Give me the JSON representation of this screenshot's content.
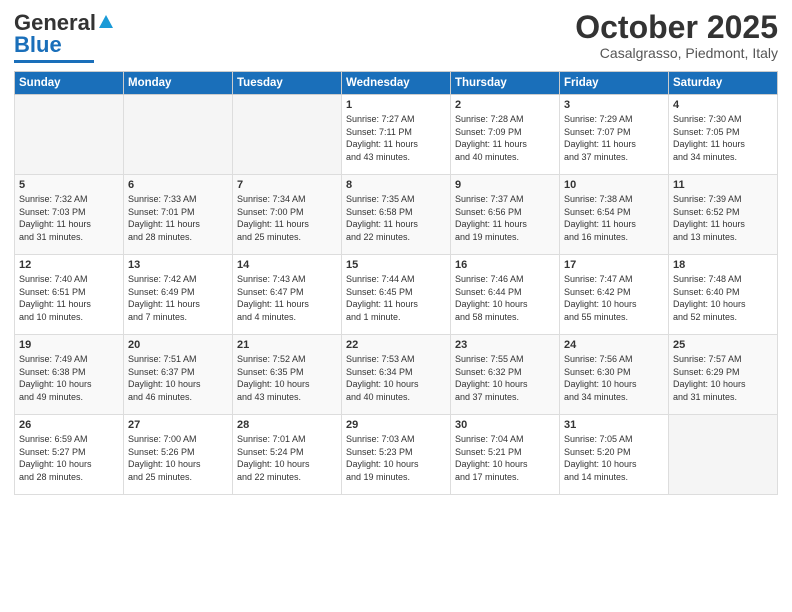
{
  "header": {
    "logo_line1": "General",
    "logo_line2": "Blue",
    "month_title": "October 2025",
    "location": "Casalgrasso, Piedmont, Italy"
  },
  "days_of_week": [
    "Sunday",
    "Monday",
    "Tuesday",
    "Wednesday",
    "Thursday",
    "Friday",
    "Saturday"
  ],
  "weeks": [
    [
      {
        "day": "",
        "info": ""
      },
      {
        "day": "",
        "info": ""
      },
      {
        "day": "",
        "info": ""
      },
      {
        "day": "1",
        "info": "Sunrise: 7:27 AM\nSunset: 7:11 PM\nDaylight: 11 hours\nand 43 minutes."
      },
      {
        "day": "2",
        "info": "Sunrise: 7:28 AM\nSunset: 7:09 PM\nDaylight: 11 hours\nand 40 minutes."
      },
      {
        "day": "3",
        "info": "Sunrise: 7:29 AM\nSunset: 7:07 PM\nDaylight: 11 hours\nand 37 minutes."
      },
      {
        "day": "4",
        "info": "Sunrise: 7:30 AM\nSunset: 7:05 PM\nDaylight: 11 hours\nand 34 minutes."
      }
    ],
    [
      {
        "day": "5",
        "info": "Sunrise: 7:32 AM\nSunset: 7:03 PM\nDaylight: 11 hours\nand 31 minutes."
      },
      {
        "day": "6",
        "info": "Sunrise: 7:33 AM\nSunset: 7:01 PM\nDaylight: 11 hours\nand 28 minutes."
      },
      {
        "day": "7",
        "info": "Sunrise: 7:34 AM\nSunset: 7:00 PM\nDaylight: 11 hours\nand 25 minutes."
      },
      {
        "day": "8",
        "info": "Sunrise: 7:35 AM\nSunset: 6:58 PM\nDaylight: 11 hours\nand 22 minutes."
      },
      {
        "day": "9",
        "info": "Sunrise: 7:37 AM\nSunset: 6:56 PM\nDaylight: 11 hours\nand 19 minutes."
      },
      {
        "day": "10",
        "info": "Sunrise: 7:38 AM\nSunset: 6:54 PM\nDaylight: 11 hours\nand 16 minutes."
      },
      {
        "day": "11",
        "info": "Sunrise: 7:39 AM\nSunset: 6:52 PM\nDaylight: 11 hours\nand 13 minutes."
      }
    ],
    [
      {
        "day": "12",
        "info": "Sunrise: 7:40 AM\nSunset: 6:51 PM\nDaylight: 11 hours\nand 10 minutes."
      },
      {
        "day": "13",
        "info": "Sunrise: 7:42 AM\nSunset: 6:49 PM\nDaylight: 11 hours\nand 7 minutes."
      },
      {
        "day": "14",
        "info": "Sunrise: 7:43 AM\nSunset: 6:47 PM\nDaylight: 11 hours\nand 4 minutes."
      },
      {
        "day": "15",
        "info": "Sunrise: 7:44 AM\nSunset: 6:45 PM\nDaylight: 11 hours\nand 1 minute."
      },
      {
        "day": "16",
        "info": "Sunrise: 7:46 AM\nSunset: 6:44 PM\nDaylight: 10 hours\nand 58 minutes."
      },
      {
        "day": "17",
        "info": "Sunrise: 7:47 AM\nSunset: 6:42 PM\nDaylight: 10 hours\nand 55 minutes."
      },
      {
        "day": "18",
        "info": "Sunrise: 7:48 AM\nSunset: 6:40 PM\nDaylight: 10 hours\nand 52 minutes."
      }
    ],
    [
      {
        "day": "19",
        "info": "Sunrise: 7:49 AM\nSunset: 6:38 PM\nDaylight: 10 hours\nand 49 minutes."
      },
      {
        "day": "20",
        "info": "Sunrise: 7:51 AM\nSunset: 6:37 PM\nDaylight: 10 hours\nand 46 minutes."
      },
      {
        "day": "21",
        "info": "Sunrise: 7:52 AM\nSunset: 6:35 PM\nDaylight: 10 hours\nand 43 minutes."
      },
      {
        "day": "22",
        "info": "Sunrise: 7:53 AM\nSunset: 6:34 PM\nDaylight: 10 hours\nand 40 minutes."
      },
      {
        "day": "23",
        "info": "Sunrise: 7:55 AM\nSunset: 6:32 PM\nDaylight: 10 hours\nand 37 minutes."
      },
      {
        "day": "24",
        "info": "Sunrise: 7:56 AM\nSunset: 6:30 PM\nDaylight: 10 hours\nand 34 minutes."
      },
      {
        "day": "25",
        "info": "Sunrise: 7:57 AM\nSunset: 6:29 PM\nDaylight: 10 hours\nand 31 minutes."
      }
    ],
    [
      {
        "day": "26",
        "info": "Sunrise: 6:59 AM\nSunset: 5:27 PM\nDaylight: 10 hours\nand 28 minutes."
      },
      {
        "day": "27",
        "info": "Sunrise: 7:00 AM\nSunset: 5:26 PM\nDaylight: 10 hours\nand 25 minutes."
      },
      {
        "day": "28",
        "info": "Sunrise: 7:01 AM\nSunset: 5:24 PM\nDaylight: 10 hours\nand 22 minutes."
      },
      {
        "day": "29",
        "info": "Sunrise: 7:03 AM\nSunset: 5:23 PM\nDaylight: 10 hours\nand 19 minutes."
      },
      {
        "day": "30",
        "info": "Sunrise: 7:04 AM\nSunset: 5:21 PM\nDaylight: 10 hours\nand 17 minutes."
      },
      {
        "day": "31",
        "info": "Sunrise: 7:05 AM\nSunset: 5:20 PM\nDaylight: 10 hours\nand 14 minutes."
      },
      {
        "day": "",
        "info": ""
      }
    ]
  ]
}
